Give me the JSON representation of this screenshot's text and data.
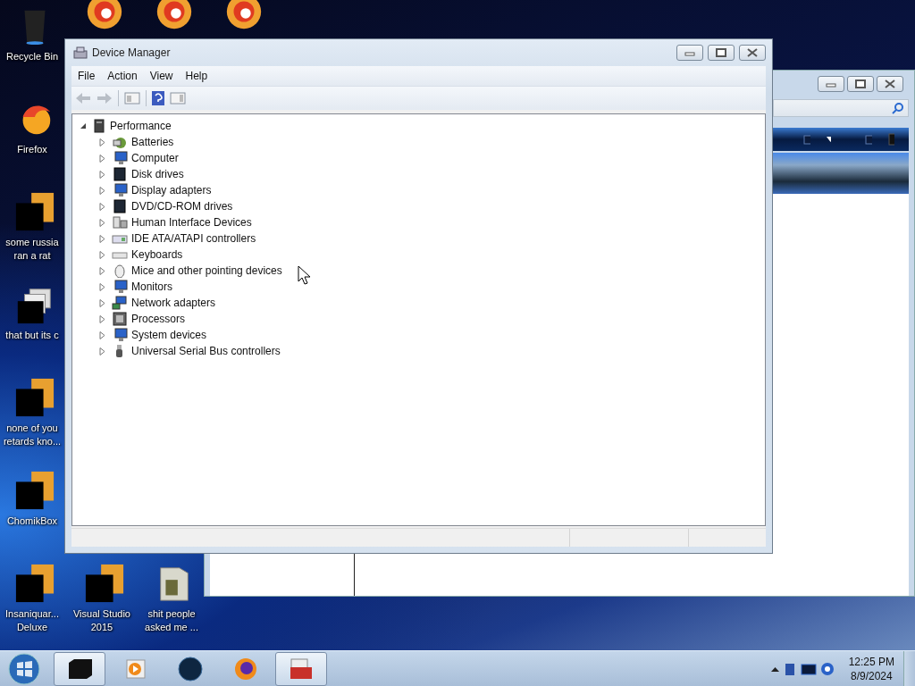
{
  "desktop_icons": [
    {
      "kind": "bin",
      "label": "Recycle Bin"
    },
    {
      "kind": "firefox",
      "label": "Firefox"
    },
    {
      "kind": "redacted",
      "label": "some russia ran a rat"
    },
    {
      "kind": "stack",
      "label": "that but its c"
    },
    {
      "kind": "redacted",
      "label": "none of you retards kno..."
    },
    {
      "kind": "redacted",
      "label": "ChomikBox"
    },
    {
      "kind": "redacted",
      "label": "Insaniquar... Deluxe"
    },
    {
      "kind": "redacted",
      "label": "Visual Studio 2015"
    },
    {
      "kind": "folder",
      "label": "shit people asked me ..."
    },
    {
      "kind": "swirl"
    },
    {
      "kind": "swirl"
    },
    {
      "kind": "swirl"
    }
  ],
  "window": {
    "title": "Device Manager",
    "menu": [
      "File",
      "Action",
      "View",
      "Help"
    ],
    "tree": {
      "label": "Performance",
      "kind": "computer",
      "expanded": true,
      "children": [
        {
          "label": "Batteries",
          "kind": "battery",
          "expanded": false
        },
        {
          "label": "Computer",
          "kind": "monitor",
          "expanded": false
        },
        {
          "label": "Disk drives",
          "kind": "disk",
          "expanded": false
        },
        {
          "label": "Display adapters",
          "kind": "monitor",
          "expanded": false
        },
        {
          "label": "DVD/CD-ROM drives",
          "kind": "disk",
          "expanded": false
        },
        {
          "label": "Human Interface Devices",
          "kind": "hid",
          "expanded": false
        },
        {
          "label": "IDE ATA/ATAPI controllers",
          "kind": "card",
          "expanded": false
        },
        {
          "label": "Keyboards",
          "kind": "keyboard",
          "expanded": false
        },
        {
          "label": "Mice and other pointing devices",
          "kind": "mouse",
          "expanded": false
        },
        {
          "label": "Monitors",
          "kind": "monitor",
          "expanded": false
        },
        {
          "label": "Network adapters",
          "kind": "network",
          "expanded": false
        },
        {
          "label": "Processors",
          "kind": "chip",
          "expanded": false
        },
        {
          "label": "System devices",
          "kind": "monitor",
          "expanded": false
        },
        {
          "label": "Universal Serial Bus controllers",
          "kind": "usb",
          "expanded": false
        }
      ]
    }
  },
  "taskbar": {
    "items": [
      {
        "kind": "black-app",
        "active": true
      },
      {
        "kind": "media",
        "active": false
      },
      {
        "kind": "globe",
        "active": false
      },
      {
        "kind": "firefox",
        "active": false
      },
      {
        "kind": "toolbox",
        "active": true
      }
    ],
    "clock": {
      "time": "12:25 PM",
      "date": "8/9/2024"
    }
  }
}
